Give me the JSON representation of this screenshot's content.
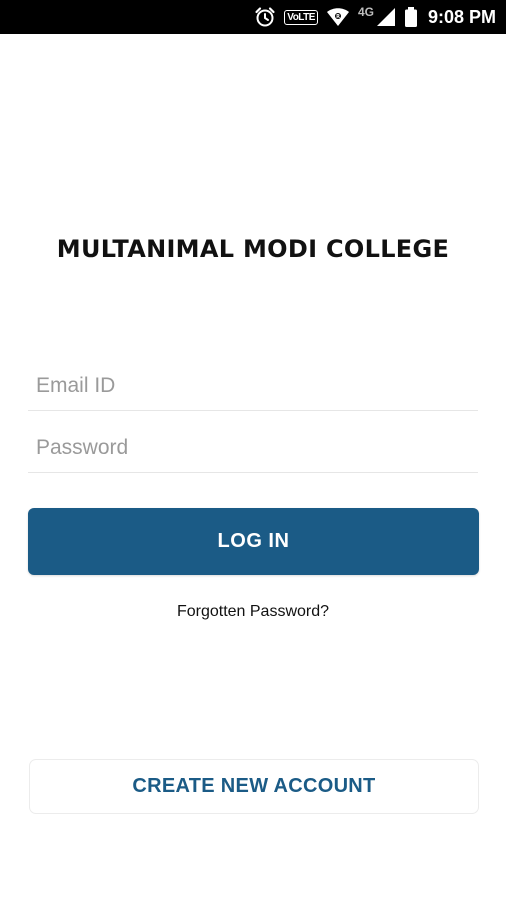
{
  "status_bar": {
    "icons": [
      "alarm-icon",
      "volte-icon",
      "wifi-icon",
      "signal-icon",
      "battery-icon"
    ],
    "volte_label": "VoLTE",
    "network_label": "4G",
    "time": "9:08 PM"
  },
  "login": {
    "title": "MULTANIMAL MODI COLLEGE",
    "email_placeholder": "Email ID",
    "email_value": "",
    "password_placeholder": "Password",
    "password_value": "",
    "login_button": "LOG IN",
    "forgot_link": "Forgotten Password?",
    "create_account_button": "CREATE NEW ACCOUNT"
  },
  "colors": {
    "primary": "#1b5b86",
    "status_bar_bg": "#000000",
    "background": "#ffffff",
    "placeholder": "#9a9a9a"
  }
}
